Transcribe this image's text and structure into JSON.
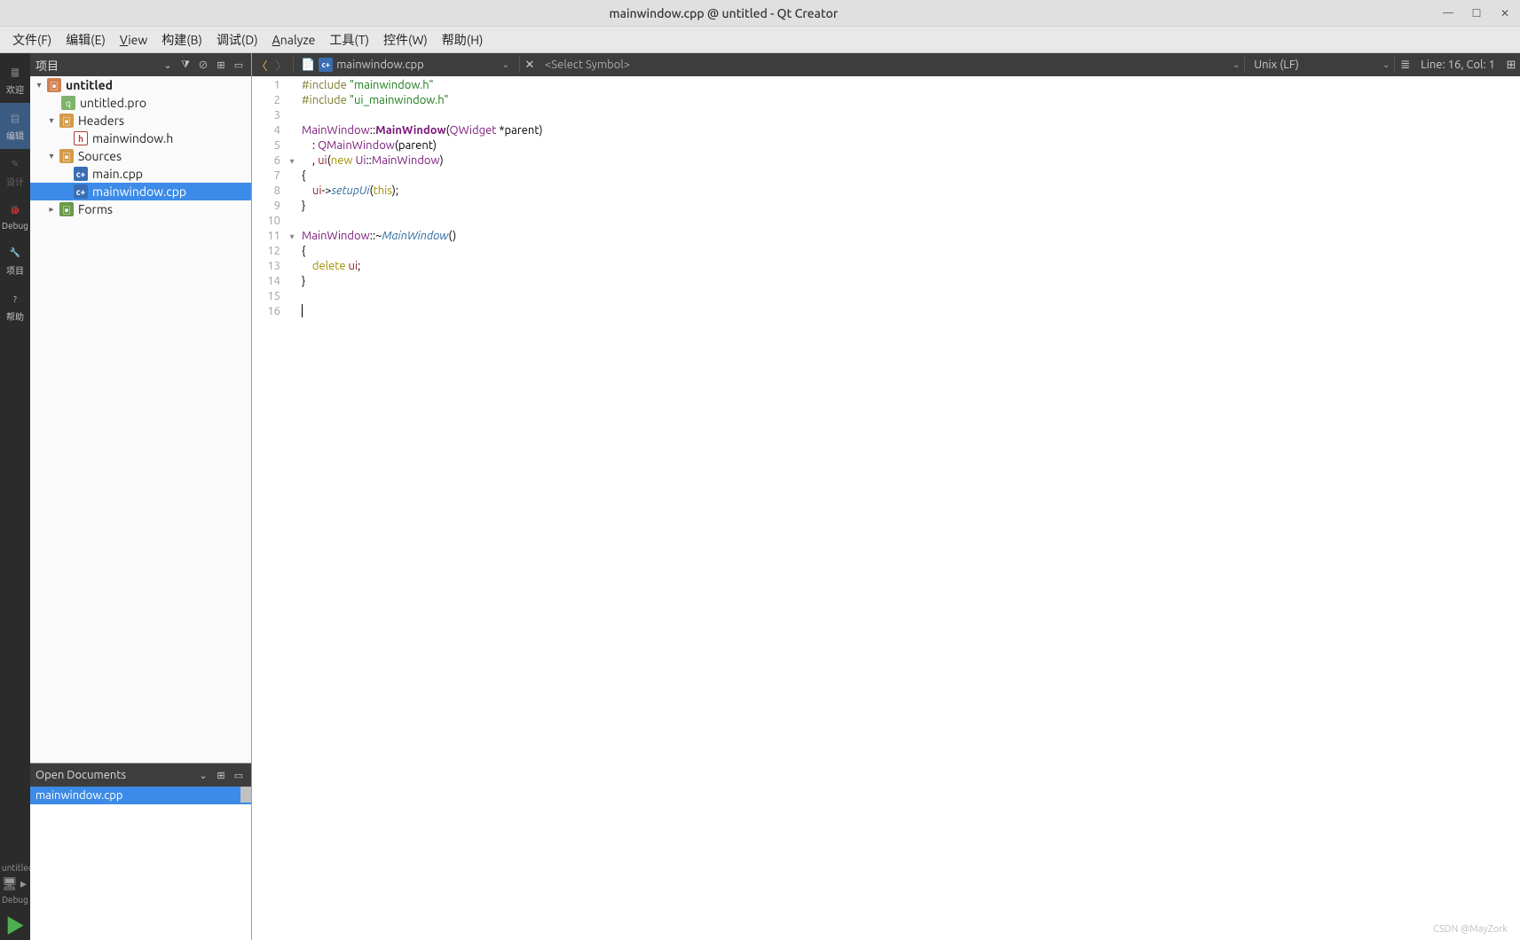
{
  "window": {
    "title": "mainwindow.cpp @ untitled - Qt Creator"
  },
  "menu": {
    "file": "文件(F)",
    "edit": "编辑(E)",
    "view": "View",
    "build": "构建(B)",
    "debug": "调试(D)",
    "analyze": "Analyze",
    "tools": "工具(T)",
    "widgets": "控件(W)",
    "help": "帮助(H)"
  },
  "modes": {
    "welcome": "欢迎",
    "edit": "编辑",
    "design": "设计",
    "debug": "Debug",
    "projects": "项目",
    "help": "帮助"
  },
  "kit": {
    "project": "untitled",
    "config": "Debug"
  },
  "projects_panel": {
    "title": "项目",
    "tree": {
      "root": "untitled",
      "pro_file": "untitled.pro",
      "headers": "Headers",
      "header_file": "mainwindow.h",
      "sources": "Sources",
      "source_main": "main.cpp",
      "source_mw": "mainwindow.cpp",
      "forms": "Forms"
    }
  },
  "open_docs": {
    "title": "Open Documents",
    "items": [
      "mainwindow.cpp"
    ]
  },
  "editor_toolbar": {
    "file": "mainwindow.cpp",
    "symbol": "<Select Symbol>",
    "encoding": "Unix (LF)",
    "linecol": "Line: 16, Col: 1"
  },
  "code": {
    "fold_markers": {
      "6": "▾",
      "11": "▾"
    },
    "lines": [
      [
        [
          "pre",
          "#include"
        ],
        [
          "",
          " "
        ],
        [
          "str",
          "\"mainwindow.h\""
        ]
      ],
      [
        [
          "pre",
          "#include"
        ],
        [
          "",
          " "
        ],
        [
          "str",
          "\"ui_mainwindow.h\""
        ]
      ],
      [],
      [
        [
          "type",
          "MainWindow"
        ],
        [
          "",
          "::"
        ],
        [
          "type-b",
          "MainWindow"
        ],
        [
          "",
          "("
        ],
        [
          "type",
          "QWidget"
        ],
        [
          "",
          " *parent)"
        ]
      ],
      [
        [
          "",
          "    : "
        ],
        [
          "type",
          "QMainWindow"
        ],
        [
          "",
          "(parent)"
        ]
      ],
      [
        [
          "",
          "    , "
        ],
        [
          "mem",
          "ui"
        ],
        [
          "",
          "("
        ],
        [
          "kw",
          "new"
        ],
        [
          "",
          " "
        ],
        [
          "type",
          "Ui"
        ],
        [
          "",
          "::"
        ],
        [
          "type",
          "MainWindow"
        ],
        [
          "",
          ")"
        ]
      ],
      [
        [
          "",
          "{"
        ]
      ],
      [
        [
          "",
          "    "
        ],
        [
          "mem",
          "ui"
        ],
        [
          "",
          "->"
        ],
        [
          "func",
          "setupUi"
        ],
        [
          "",
          "("
        ],
        [
          "kw",
          "this"
        ],
        [
          "",
          ");"
        ]
      ],
      [
        [
          "",
          "}"
        ]
      ],
      [],
      [
        [
          "type",
          "MainWindow"
        ],
        [
          "",
          "::~"
        ],
        [
          "dtor",
          "MainWindow"
        ],
        [
          "",
          "()"
        ]
      ],
      [
        [
          "",
          "{"
        ]
      ],
      [
        [
          "",
          "    "
        ],
        [
          "kw",
          "delete"
        ],
        [
          "",
          " "
        ],
        [
          "mem",
          "ui"
        ],
        [
          "",
          ";"
        ]
      ],
      [
        [
          "",
          "}"
        ]
      ],
      [],
      []
    ]
  },
  "watermark": "CSDN @MayZork"
}
